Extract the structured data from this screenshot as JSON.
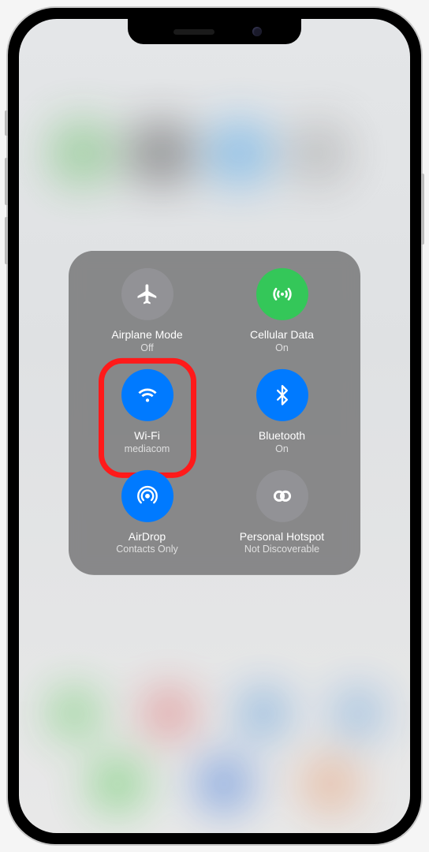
{
  "tiles": {
    "airplane": {
      "label": "Airplane Mode",
      "status": "Off"
    },
    "cellular": {
      "label": "Cellular Data",
      "status": "On"
    },
    "wifi": {
      "label": "Wi-Fi",
      "status": "mediacom"
    },
    "bluetooth": {
      "label": "Bluetooth",
      "status": "On"
    },
    "airdrop": {
      "label": "AirDrop",
      "status": "Contacts Only"
    },
    "hotspot": {
      "label": "Personal Hotspot",
      "status": "Not Discoverable"
    }
  }
}
